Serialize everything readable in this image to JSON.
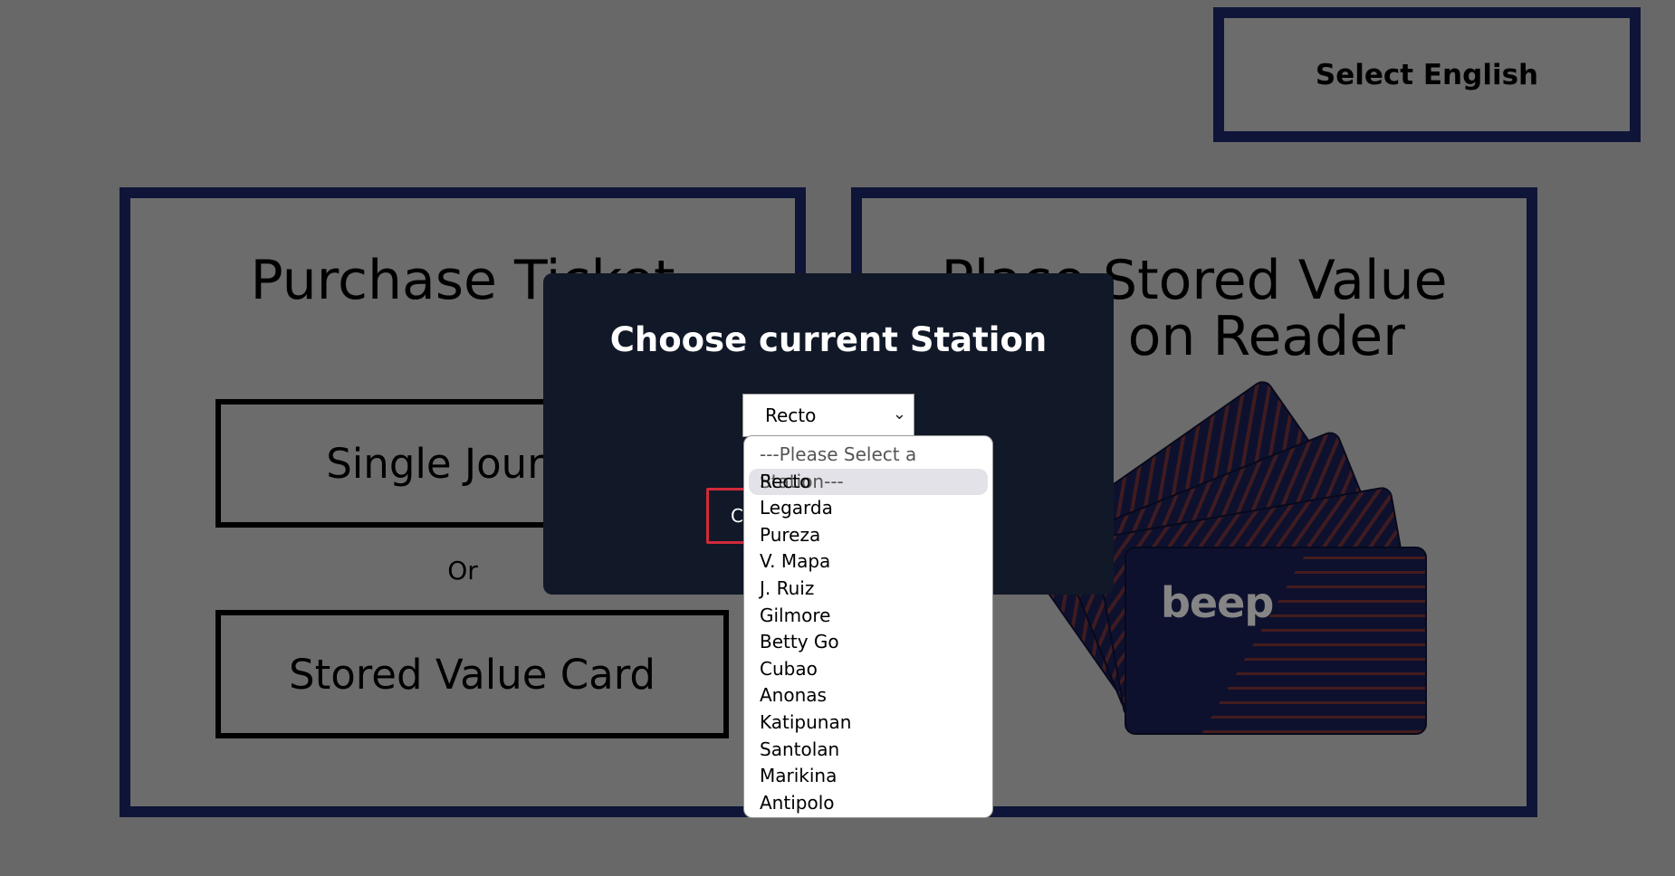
{
  "language_button": "Select English",
  "purchase_panel": {
    "title": "Purchase Ticket",
    "single_journey": "Single Journey",
    "or_text": "Or",
    "stored_value": "Stored Value Card"
  },
  "reader_panel": {
    "title_line1": "Place Stored Value",
    "title_line2": "Card on Reader",
    "card_brand": "beep"
  },
  "modal": {
    "title": "Choose current Station",
    "selected_station": "Recto",
    "confirm_label": "Confirm"
  },
  "dropdown": {
    "placeholder": "---Please Select a Station---",
    "options": [
      "Recto",
      "Legarda",
      "Pureza",
      "V. Mapa",
      "J. Ruiz",
      "Gilmore",
      "Betty Go",
      "Cubao",
      "Anonas",
      "Katipunan",
      "Santolan",
      "Marikina",
      "Antipolo"
    ],
    "selected_index": 0
  },
  "colors": {
    "border_navy": "#1b2a6b",
    "modal_bg": "#111827",
    "confirm_border": "#d02a3a"
  }
}
